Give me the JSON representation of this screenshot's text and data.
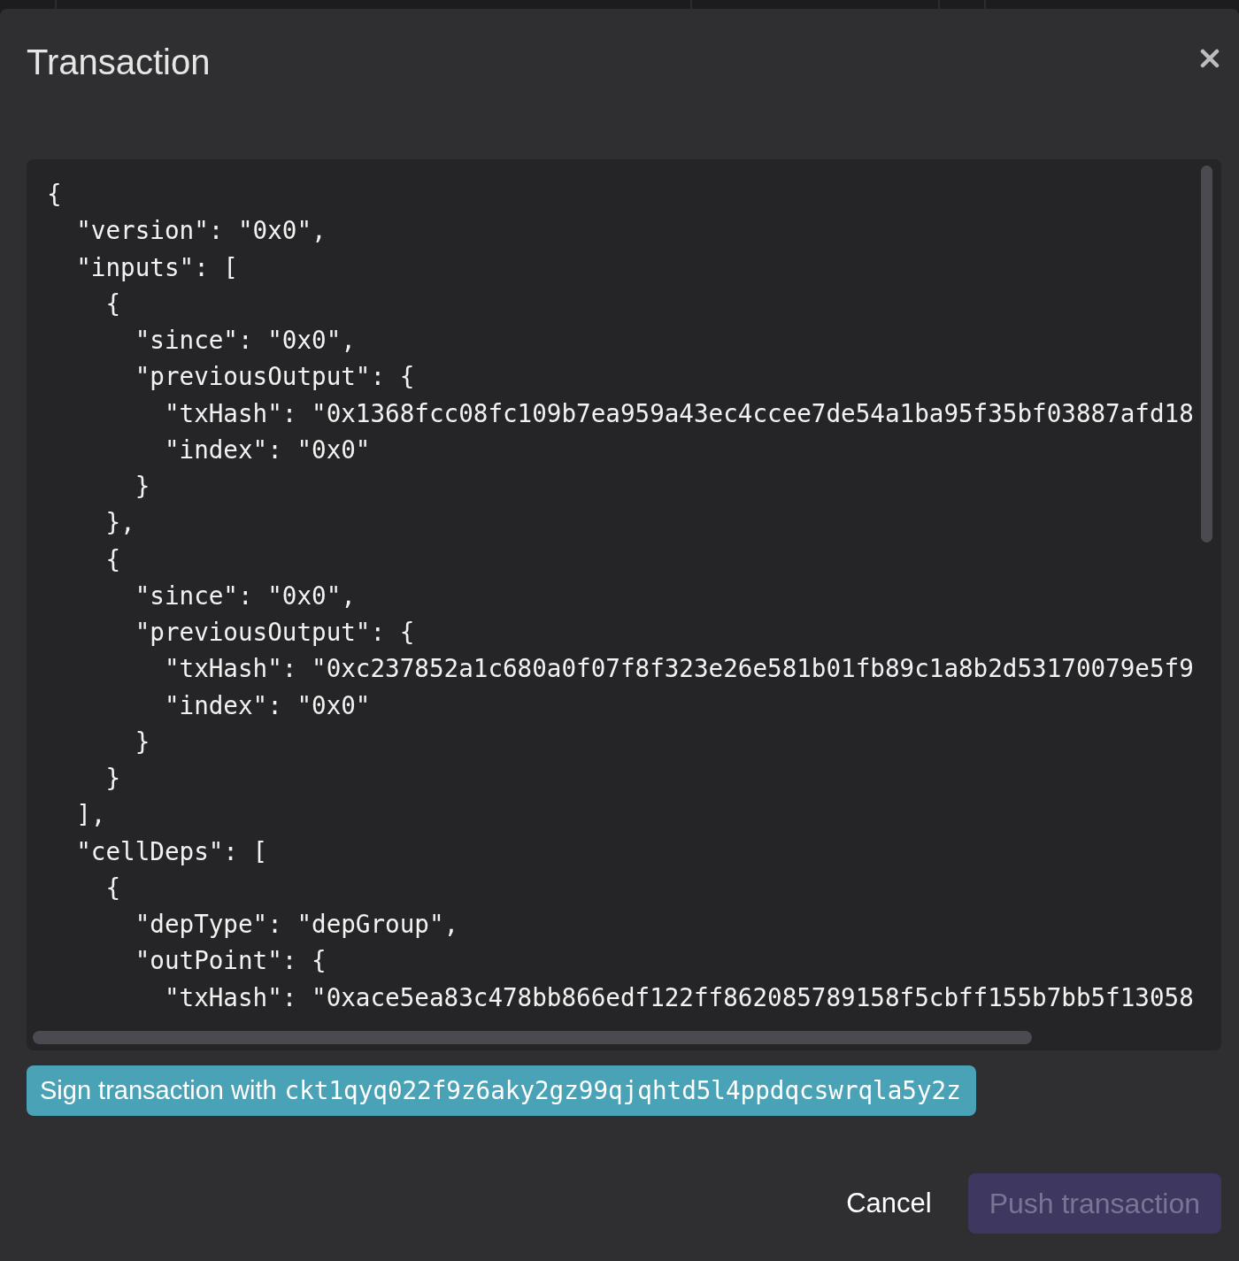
{
  "dialog": {
    "title": "Transaction"
  },
  "code_view": {
    "lines": [
      "{",
      "  \"version\": \"0x0\",",
      "  \"inputs\": [",
      "    {",
      "      \"since\": \"0x0\",",
      "      \"previousOutput\": {",
      "        \"txHash\": \"0x1368fcc08fc109b7ea959a43ec4ccee7de54a1ba95f35bf03887afd18",
      "        \"index\": \"0x0\"",
      "      }",
      "    },",
      "    {",
      "      \"since\": \"0x0\",",
      "      \"previousOutput\": {",
      "        \"txHash\": \"0xc237852a1c680a0f07f8f323e26e581b01fb89c1a8b2d53170079e5f9",
      "        \"index\": \"0x0\"",
      "      }",
      "    }",
      "  ],",
      "  \"cellDeps\": [",
      "    {",
      "      \"depType\": \"depGroup\",",
      "      \"outPoint\": {",
      "        \"txHash\": \"0xace5ea83c478bb866edf122ff862085789158f5cbff155b7bb5f13058"
    ]
  },
  "sign_button": {
    "label": "Sign transaction with",
    "address": "ckt1qyq022f9z6aky2gz99qjqhtd5l4ppdqcswrqla5y2z"
  },
  "actions": [
    {
      "label": "Cancel",
      "kind": "text",
      "disabled": false
    },
    {
      "label": "Push transaction",
      "kind": "primary",
      "disabled": true
    }
  ]
}
